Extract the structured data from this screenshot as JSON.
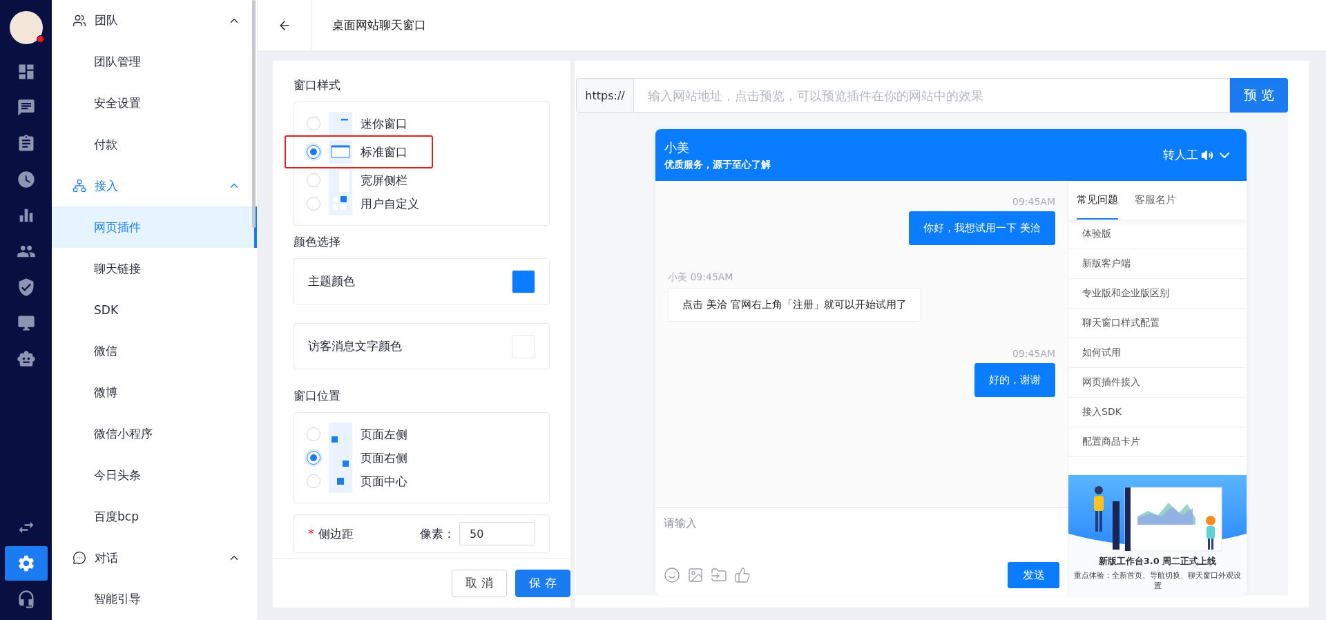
{
  "rail": {
    "avatar_badge": true,
    "items": [
      {
        "kind": "dashboard",
        "selected": false
      },
      {
        "kind": "chat",
        "selected": false
      },
      {
        "kind": "clipboard",
        "selected": false
      },
      {
        "kind": "clock",
        "selected": false
      },
      {
        "kind": "bars",
        "selected": false
      },
      {
        "kind": "people",
        "selected": false
      },
      {
        "kind": "shield",
        "selected": false
      },
      {
        "kind": "monitor",
        "selected": false
      },
      {
        "kind": "robot",
        "selected": false
      }
    ],
    "bottom_items": [
      {
        "kind": "swap",
        "selected": false
      },
      {
        "kind": "settings",
        "selected": true
      },
      {
        "kind": "headset",
        "selected": false
      }
    ]
  },
  "nav": {
    "groups": [
      {
        "label": "团队",
        "kind": "team",
        "selected": false,
        "expanded": true,
        "children": [
          {
            "label": "团队管理",
            "selected": false
          },
          {
            "label": "安全设置",
            "selected": false
          },
          {
            "label": "付款",
            "selected": false
          }
        ]
      },
      {
        "label": "接入",
        "kind": "network",
        "selected": true,
        "expanded": true,
        "children": [
          {
            "label": "网页插件",
            "selected": true
          },
          {
            "label": "聊天链接",
            "selected": false
          },
          {
            "label": "SDK",
            "selected": false
          },
          {
            "label": "微信",
            "selected": false
          },
          {
            "label": "微博",
            "selected": false
          },
          {
            "label": "微信小程序",
            "selected": false
          },
          {
            "label": "今日头条",
            "selected": false
          },
          {
            "label": "百度bcp",
            "selected": false
          }
        ]
      },
      {
        "label": "对话",
        "kind": "dialog",
        "selected": false,
        "expanded": true,
        "children": [
          {
            "label": "智能引导",
            "selected": false
          }
        ]
      }
    ]
  },
  "topbar": {
    "title": "桌面网站聊天窗口"
  },
  "form": {
    "window_style": {
      "title": "窗口样式",
      "options": [
        {
          "label": "迷你窗口",
          "kind": "mini",
          "selected": false,
          "highlighted": false
        },
        {
          "label": "标准窗口",
          "kind": "standard",
          "selected": true,
          "highlighted": true
        },
        {
          "label": "宽屏侧栏",
          "kind": "sidebar",
          "selected": false,
          "highlighted": false
        },
        {
          "label": "用户自定义",
          "kind": "custom",
          "selected": false,
          "highlighted": false
        }
      ]
    },
    "color_select": {
      "title": "颜色选择",
      "items": [
        {
          "label": "主题颜色",
          "color": "#0a7cff"
        },
        {
          "label": "访客消息文字颜色",
          "color": "#ffffff"
        }
      ]
    },
    "window_position": {
      "title": "窗口位置",
      "options": [
        {
          "label": "页面左侧",
          "kind": "left",
          "selected": false
        },
        {
          "label": "页面右侧",
          "kind": "right",
          "selected": true
        },
        {
          "label": "页面中心",
          "kind": "center",
          "selected": false
        }
      ]
    },
    "side_margin": {
      "label": "侧边距",
      "required": true,
      "required_mark": "*",
      "unit_label": "像素：",
      "value": "50"
    },
    "buttons": {
      "cancel": "取 消",
      "save": "保 存"
    }
  },
  "preview": {
    "url_prefix": "https://",
    "url_placeholder": "输入网站地址，点击预览，可以预览插件在你的网站中的效果",
    "preview_button": "预 览",
    "chat": {
      "title": "小美",
      "subtitle": "优质服务，源于至心了解",
      "transfer_label": "转人工",
      "messages": [
        {
          "kind": "visitor",
          "time": "09:45AM",
          "text": "你好，我想试用一下 美洽"
        },
        {
          "kind": "agent",
          "time": "小美 09:45AM",
          "text": "点击 美洽 官网右上角「注册」就可以开始试用了"
        },
        {
          "kind": "visitor",
          "time": "09:45AM",
          "text": "好的，谢谢"
        }
      ],
      "input_placeholder": "请输入",
      "send_button": "发送",
      "tabs": [
        {
          "label": "常见问题",
          "selected": true
        },
        {
          "label": "客服名片",
          "selected": false
        }
      ],
      "faq": [
        "体验版",
        "新版客户端",
        "专业版和企业版区别",
        "聊天窗口样式配置",
        "如何试用",
        "网页插件接入",
        "接入SDK",
        "配置商品卡片"
      ],
      "banner": {
        "title": "新版工作台3.0 周二正式上线",
        "subtitle": "重点体验：全新首页、导航切换、聊天窗口外观设置"
      }
    }
  }
}
